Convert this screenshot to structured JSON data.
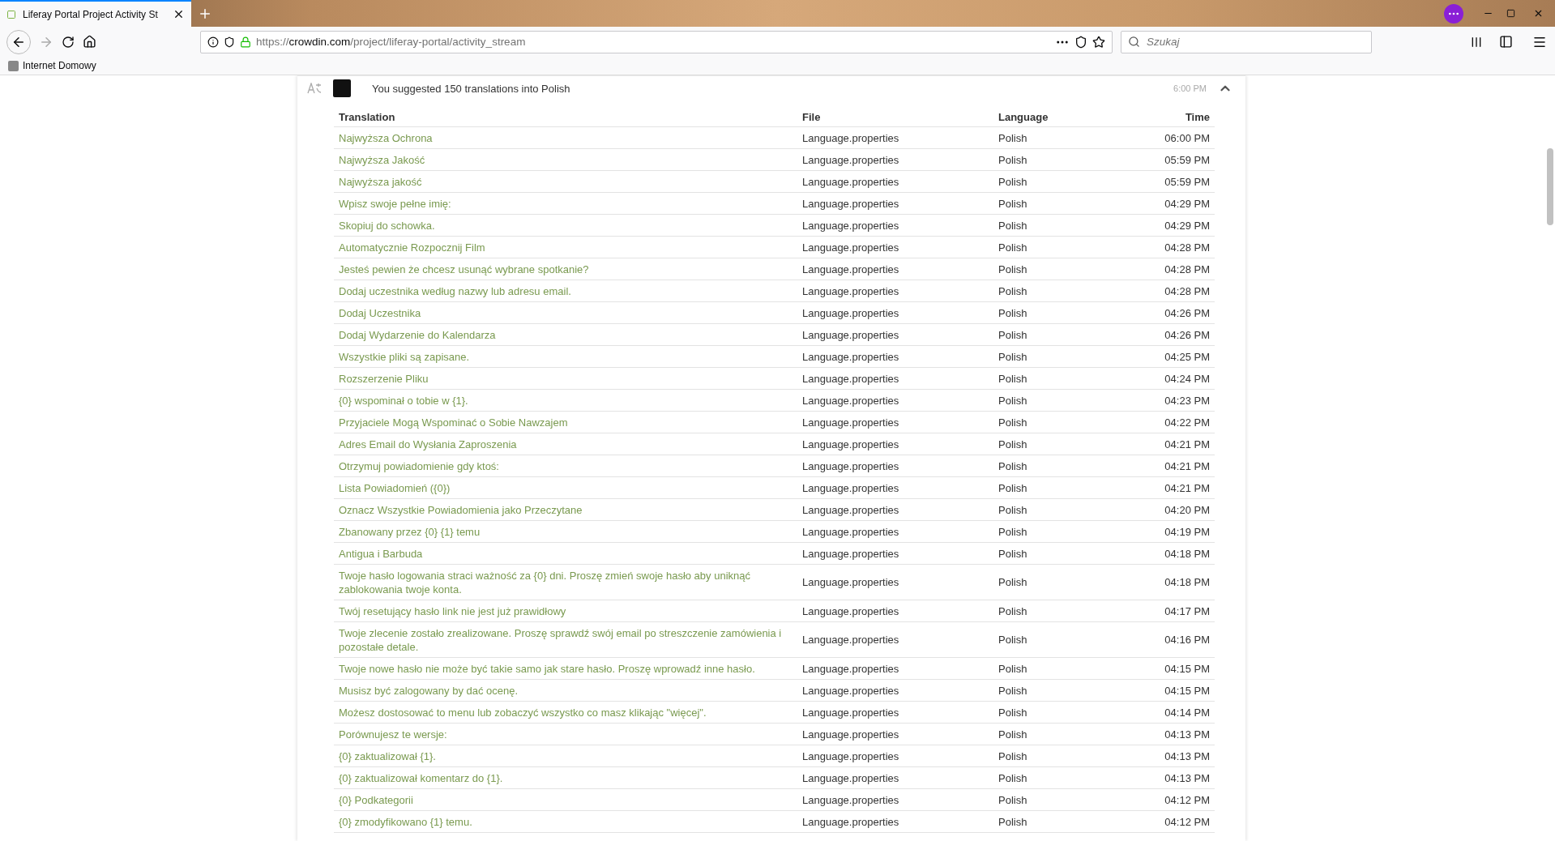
{
  "browser": {
    "tab": {
      "title": "Liferay Portal Project Activity St",
      "selected": true
    },
    "url": {
      "scheme": "https://",
      "host": "crowdin.com",
      "path": "/project/liferay-portal/activity_stream"
    },
    "search": {
      "placeholder": "Szukaj"
    },
    "bookmarks": [
      "Internet Domowy"
    ]
  },
  "activity": {
    "message": "You suggested 150 translations into Polish",
    "time": "6:00 PM",
    "expanded": true
  },
  "table": {
    "columns": [
      "Translation",
      "File",
      "Language",
      "Time"
    ],
    "rows": [
      {
        "translation": "Najwyższa Ochrona",
        "file": "Language.properties",
        "language": "Polish",
        "time": "06:00 PM"
      },
      {
        "translation": "Najwyższa Jakość",
        "file": "Language.properties",
        "language": "Polish",
        "time": "05:59 PM"
      },
      {
        "translation": "Najwyższa jakość",
        "file": "Language.properties",
        "language": "Polish",
        "time": "05:59 PM"
      },
      {
        "translation": "Wpisz swoje pełne imię:",
        "file": "Language.properties",
        "language": "Polish",
        "time": "04:29 PM"
      },
      {
        "translation": "Skopiuj do schowka.",
        "file": "Language.properties",
        "language": "Polish",
        "time": "04:29 PM"
      },
      {
        "translation": "Automatycznie Rozpocznij Film",
        "file": "Language.properties",
        "language": "Polish",
        "time": "04:28 PM"
      },
      {
        "translation": "Jesteś pewien że chcesz usunąć wybrane spotkanie?",
        "file": "Language.properties",
        "language": "Polish",
        "time": "04:28 PM"
      },
      {
        "translation": "Dodaj uczestnika według nazwy lub adresu email.",
        "file": "Language.properties",
        "language": "Polish",
        "time": "04:28 PM"
      },
      {
        "translation": "Dodaj Uczestnika",
        "file": "Language.properties",
        "language": "Polish",
        "time": "04:26 PM"
      },
      {
        "translation": "Dodaj Wydarzenie do Kalendarza",
        "file": "Language.properties",
        "language": "Polish",
        "time": "04:26 PM"
      },
      {
        "translation": "Wszystkie pliki są zapisane.",
        "file": "Language.properties",
        "language": "Polish",
        "time": "04:25 PM"
      },
      {
        "translation": "Rozszerzenie Pliku",
        "file": "Language.properties",
        "language": "Polish",
        "time": "04:24 PM"
      },
      {
        "translation": "{0} wspominał o tobie w {1}.",
        "file": "Language.properties",
        "language": "Polish",
        "time": "04:23 PM"
      },
      {
        "translation": "Przyjaciele Mogą Wspominać o Sobie Nawzajem",
        "file": "Language.properties",
        "language": "Polish",
        "time": "04:22 PM"
      },
      {
        "translation": "Adres Email do Wysłania Zaproszenia",
        "file": "Language.properties",
        "language": "Polish",
        "time": "04:21 PM"
      },
      {
        "translation": "Otrzymuj powiadomienie gdy ktoś:",
        "file": "Language.properties",
        "language": "Polish",
        "time": "04:21 PM"
      },
      {
        "translation": "Lista Powiadomień ({0})",
        "file": "Language.properties",
        "language": "Polish",
        "time": "04:21 PM"
      },
      {
        "translation": "Oznacz Wszystkie Powiadomienia jako Przeczytane",
        "file": "Language.properties",
        "language": "Polish",
        "time": "04:20 PM"
      },
      {
        "translation": "Zbanowany przez {0} {1} temu",
        "file": "Language.properties",
        "language": "Polish",
        "time": "04:19 PM"
      },
      {
        "translation": "Antigua i Barbuda",
        "file": "Language.properties",
        "language": "Polish",
        "time": "04:18 PM"
      },
      {
        "translation": "Twoje hasło logowania straci ważność za {0} dni. Proszę zmień swoje hasło aby uniknąć zablokowania twoje konta.",
        "file": "Language.properties",
        "language": "Polish",
        "time": "04:18 PM"
      },
      {
        "translation": "Twój resetujący hasło link nie jest już prawidłowy",
        "file": "Language.properties",
        "language": "Polish",
        "time": "04:17 PM"
      },
      {
        "translation": "Twoje zlecenie zostało zrealizowane. Proszę sprawdź swój email po streszczenie zamówienia i pozostałe detale.",
        "file": "Language.properties",
        "language": "Polish",
        "time": "04:16 PM"
      },
      {
        "translation": "Twoje nowe hasło nie może być takie samo jak stare hasło. Proszę wprowadź inne hasło.",
        "file": "Language.properties",
        "language": "Polish",
        "time": "04:15 PM"
      },
      {
        "translation": "Musisz być zalogowany by dać ocenę.",
        "file": "Language.properties",
        "language": "Polish",
        "time": "04:15 PM"
      },
      {
        "translation": "Możesz dostosować to menu lub zobaczyć wszystko co masz klikając \"więcej\".",
        "file": "Language.properties",
        "language": "Polish",
        "time": "04:14 PM"
      },
      {
        "translation": "Porównujesz te wersje:",
        "file": "Language.properties",
        "language": "Polish",
        "time": "04:13 PM"
      },
      {
        "translation": "{0} zaktualizował {1}.",
        "file": "Language.properties",
        "language": "Polish",
        "time": "04:13 PM"
      },
      {
        "translation": "{0} zaktualizował komentarz do {1}.",
        "file": "Language.properties",
        "language": "Polish",
        "time": "04:13 PM"
      },
      {
        "translation": "{0} Podkategorii",
        "file": "Language.properties",
        "language": "Polish",
        "time": "04:12 PM"
      },
      {
        "translation": "{0} zmodyfikowano {1} temu.",
        "file": "Language.properties",
        "language": "Polish",
        "time": "04:12 PM"
      }
    ]
  }
}
